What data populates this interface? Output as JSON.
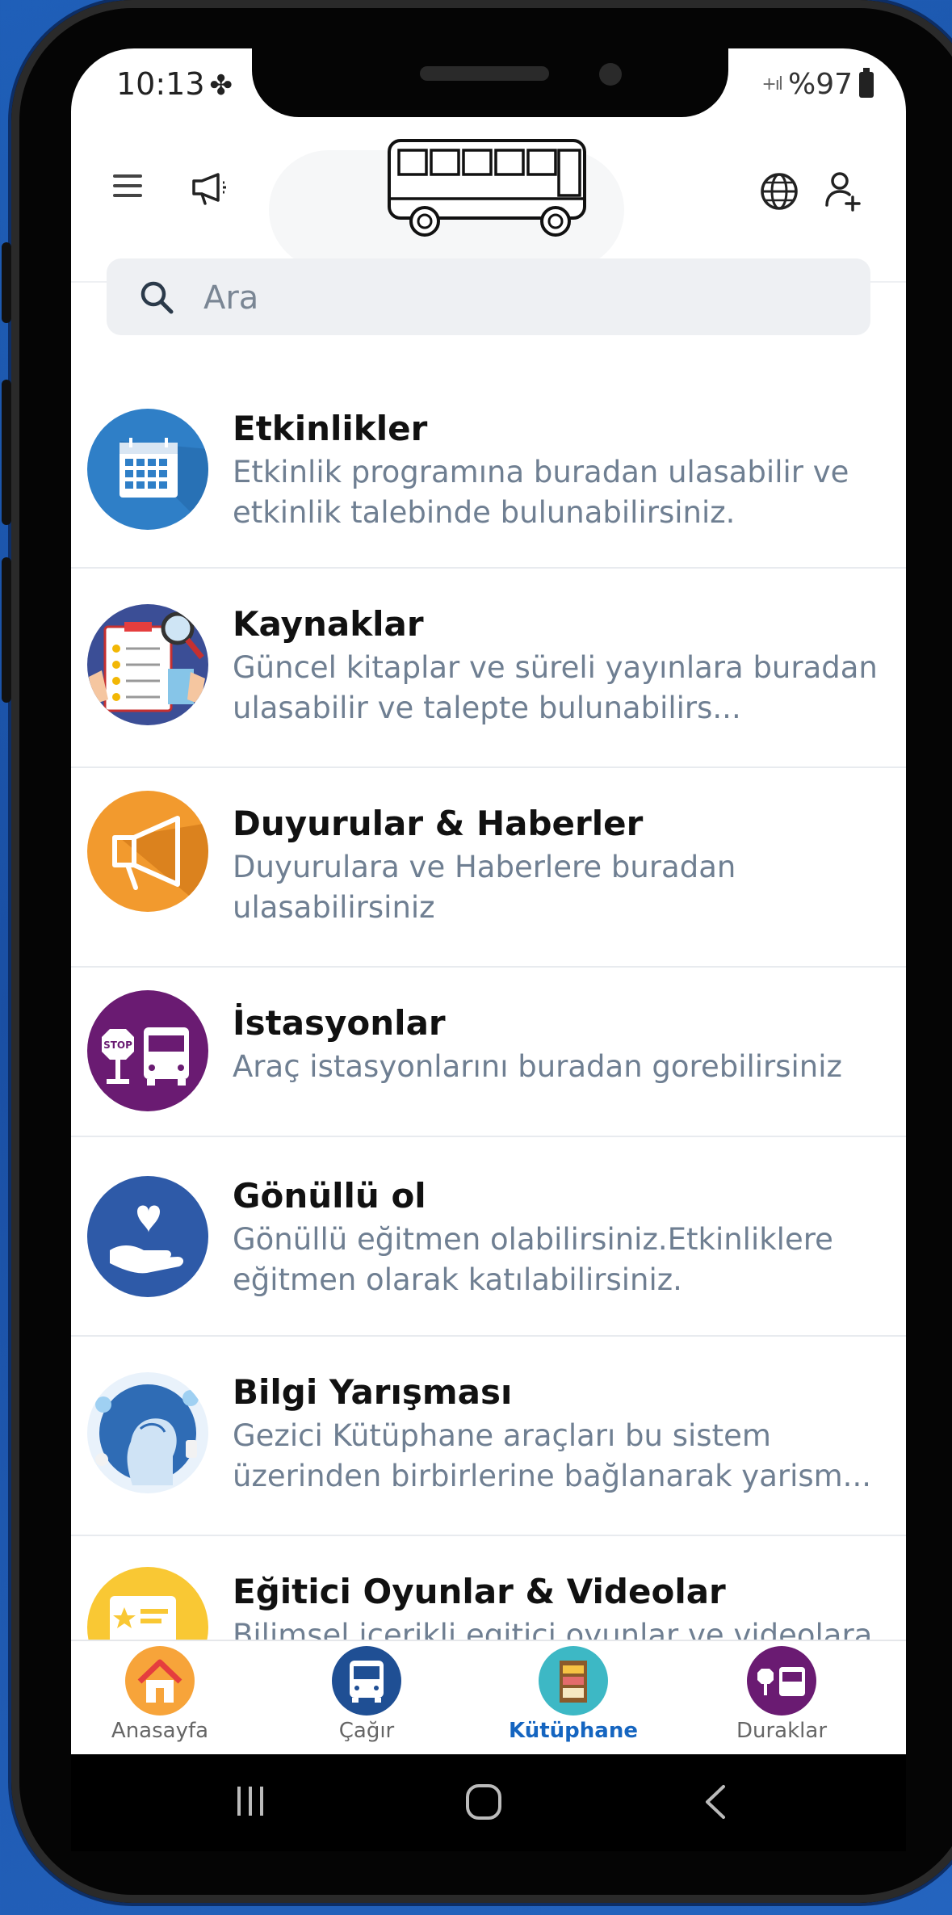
{
  "status_bar": {
    "time": "10:13",
    "battery": "%97"
  },
  "search": {
    "placeholder": "Ara"
  },
  "items": [
    {
      "title": "Etkinlikler",
      "desc": "Etkinlik programına buradan ulasabilir ve etkinlik talebinde bulunabilirsiniz.",
      "icon": "calendar-icon",
      "color": "#2f7fc7"
    },
    {
      "title": "Kaynaklar",
      "desc": "Güncel kitaplar ve süreli yayınlara buradan ulasabilir ve talepte bulunabilirs...",
      "icon": "clipboard-search-icon",
      "color": "#3b4e96"
    },
    {
      "title": "Duyurular & Haberler",
      "desc": "Duyurulara ve Haberlere buradan ulasabilirsiniz",
      "icon": "megaphone-icon",
      "color": "#f29a2e"
    },
    {
      "title": "İstasyonlar",
      "desc": "Araç istasyonlarını buradan gorebilirsiniz",
      "icon": "bus-stop-icon",
      "color": "#6a1b72"
    },
    {
      "title": "Gönüllü ol",
      "desc": "Gönüllü eğitmen olabilirsiniz.Etkinliklere eğitmen olarak katılabilirsiniz.",
      "icon": "heart-hand-icon",
      "color": "#2e5aa8"
    },
    {
      "title": "Bilgi Yarışması",
      "desc": "Gezici Kütüphane araçları bu sistem üzerinden birbirlerine bağlanarak yarism...",
      "icon": "ai-head-icon",
      "color": "#2f6cb5"
    },
    {
      "title": "Eğitici Oyunlar & Videolar",
      "desc": "Bilimsel içerikli egitici oyunlar ve videolara buradan ulasabilirsiniz.",
      "icon": "game-video-icon",
      "color": "#f9c834"
    }
  ],
  "nav": [
    {
      "label": "Anasayfa",
      "icon": "home-icon",
      "color": "#f7a43a"
    },
    {
      "label": "Çağır",
      "icon": "bus-icon",
      "color": "#1f4f94"
    },
    {
      "label": "Kütüphane",
      "icon": "library-icon",
      "color": "#3db8c5"
    },
    {
      "label": "Duraklar",
      "icon": "bus-stop-icon",
      "color": "#6a1b72"
    }
  ]
}
